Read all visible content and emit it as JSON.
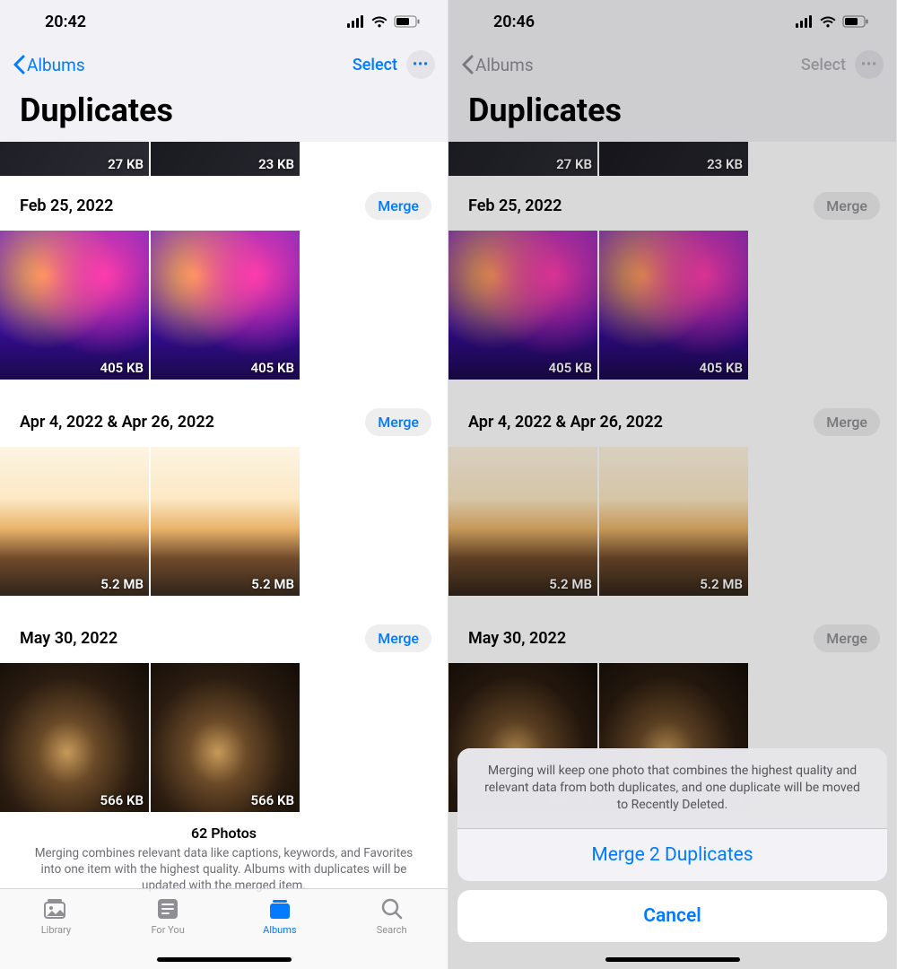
{
  "left": {
    "status_time": "20:42",
    "back_label": "Albums",
    "select_label": "Select",
    "page_title": "Duplicates",
    "peek": {
      "sizes": [
        "27 KB",
        "23 KB"
      ]
    },
    "groups": [
      {
        "date": "Feb 25, 2022",
        "merge": "Merge",
        "sizes": [
          "405 KB",
          "405 KB"
        ],
        "style": "gradient"
      },
      {
        "date": "Apr 4, 2022 & Apr 26, 2022",
        "merge": "Merge",
        "sizes": [
          "5.2 MB",
          "5.2 MB"
        ],
        "style": "sunset"
      },
      {
        "date": "May 30, 2022",
        "merge": "Merge",
        "sizes": [
          "566 KB",
          "566 KB"
        ],
        "style": "painting"
      }
    ],
    "footer_title": "62 Photos",
    "footer_desc": "Merging combines relevant data like captions, keywords, and Favorites into one item with the highest quality. Albums with duplicates will be updated with the merged item.",
    "tabs": {
      "library": "Library",
      "foryou": "For You",
      "albums": "Albums",
      "search": "Search"
    }
  },
  "right": {
    "status_time": "20:46",
    "back_label": "Albums",
    "select_label": "Select",
    "page_title": "Duplicates",
    "peek": {
      "sizes": [
        "27 KB",
        "23 KB"
      ]
    },
    "groups": [
      {
        "date": "Feb 25, 2022",
        "merge": "Merge",
        "sizes": [
          "405 KB",
          "405 KB"
        ],
        "style": "gradient"
      },
      {
        "date": "Apr 4, 2022 & Apr 26, 2022",
        "merge": "Merge",
        "sizes": [
          "5.2 MB",
          "5.2 MB"
        ],
        "style": "sunset"
      },
      {
        "date": "May 30, 2022",
        "merge": "Merge",
        "sizes": [
          "566 KB",
          "566 KB"
        ],
        "style": "painting"
      }
    ],
    "sheet": {
      "message": "Merging will keep one photo that combines the highest quality and relevant data from both duplicates, and one duplicate will be moved to Recently Deleted.",
      "action": "Merge 2 Duplicates",
      "cancel": "Cancel"
    }
  }
}
